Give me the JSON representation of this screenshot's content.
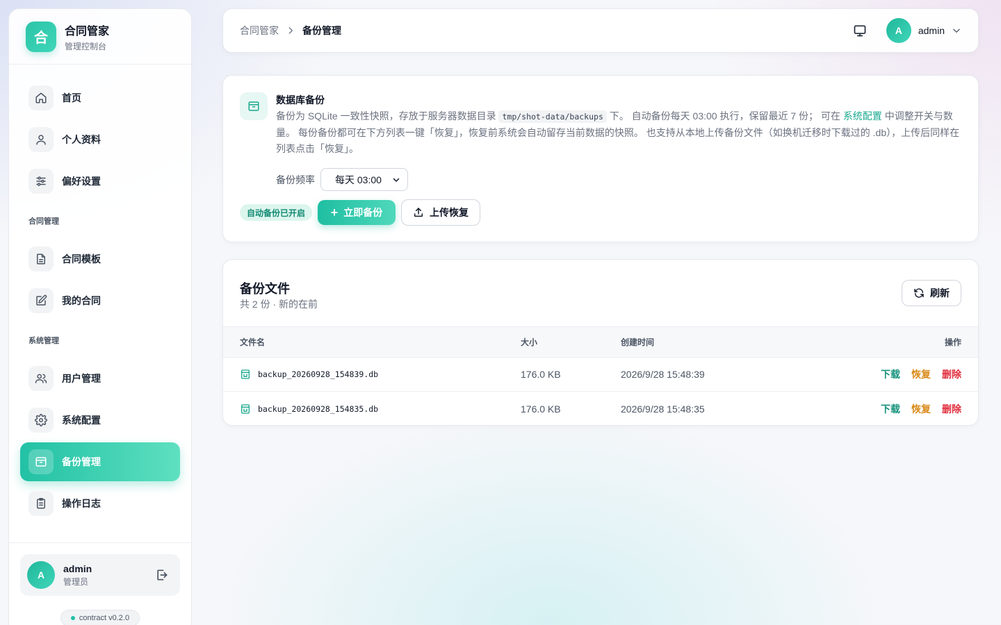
{
  "sidebar": {
    "brand_title": "合同管家",
    "brand_subtitle": "管理控制台",
    "brand_logo_char": "合",
    "nav_top": [
      {
        "label": "首页",
        "icon": "home-icon"
      },
      {
        "label": "个人资料",
        "icon": "user-icon"
      },
      {
        "label": "偏好设置",
        "icon": "sliders-icon"
      }
    ],
    "section_contract": "合同管理",
    "nav_contract": [
      {
        "label": "合同模板",
        "icon": "file-text-icon"
      },
      {
        "label": "我的合同",
        "icon": "edit-icon"
      }
    ],
    "section_system": "系统管理",
    "nav_system": [
      {
        "label": "用户管理",
        "icon": "users-icon"
      },
      {
        "label": "系统配置",
        "icon": "gear-icon"
      },
      {
        "label": "备份管理",
        "icon": "archive-icon",
        "active": true
      },
      {
        "label": "操作日志",
        "icon": "clipboard-icon"
      }
    ],
    "user": {
      "avatar": "A",
      "name": "admin",
      "role": "管理员"
    },
    "version": "contract v0.2.0"
  },
  "header": {
    "breadcrumb_root": "合同管家",
    "breadcrumb_current": "备份管理",
    "user_avatar": "A",
    "user_name": "admin"
  },
  "backup_card": {
    "title": "数据库备份",
    "desc_part1": "备份为 SQLite 一致性快照，存放于服务器数据目录 ",
    "desc_code": "tmp/shot-data/backups",
    "desc_part2": " 下。 自动备份每天 03:00 执行，保留最近 7 份； 可在 ",
    "desc_link": "系统配置",
    "desc_part3": " 中调整开关与数量。 每份备份都可在下方列表一键「恢复」，恢复前系统会自动留存当前数据的快照。 也支持从本地上传备份文件（如换机迁移时下载过的 .db），上传后同样在列表点击「恢复」。",
    "freq_label": "备份频率",
    "freq_value": "每天 03:00",
    "status_badge": "自动备份已开启",
    "backup_now": "立即备份",
    "upload_restore": "上传恢复"
  },
  "files_card": {
    "title": "备份文件",
    "subtitle": "共 2 份 · 新的在前",
    "refresh": "刷新",
    "columns": {
      "name": "文件名",
      "size": "大小",
      "time": "创建时间",
      "ops": "操作"
    },
    "rows": [
      {
        "name": "backup_20260928_154839.db",
        "size": "176.0 KB",
        "time": "2026/9/28 15:48:39"
      },
      {
        "name": "backup_20260928_154835.db",
        "size": "176.0 KB",
        "time": "2026/9/28 15:48:35"
      }
    ],
    "op_download": "下载",
    "op_restore": "恢复",
    "op_delete": "删除"
  },
  "colors": {
    "accent": "#22c1a5",
    "restore": "#d98a1a",
    "delete": "#e02d3c"
  }
}
